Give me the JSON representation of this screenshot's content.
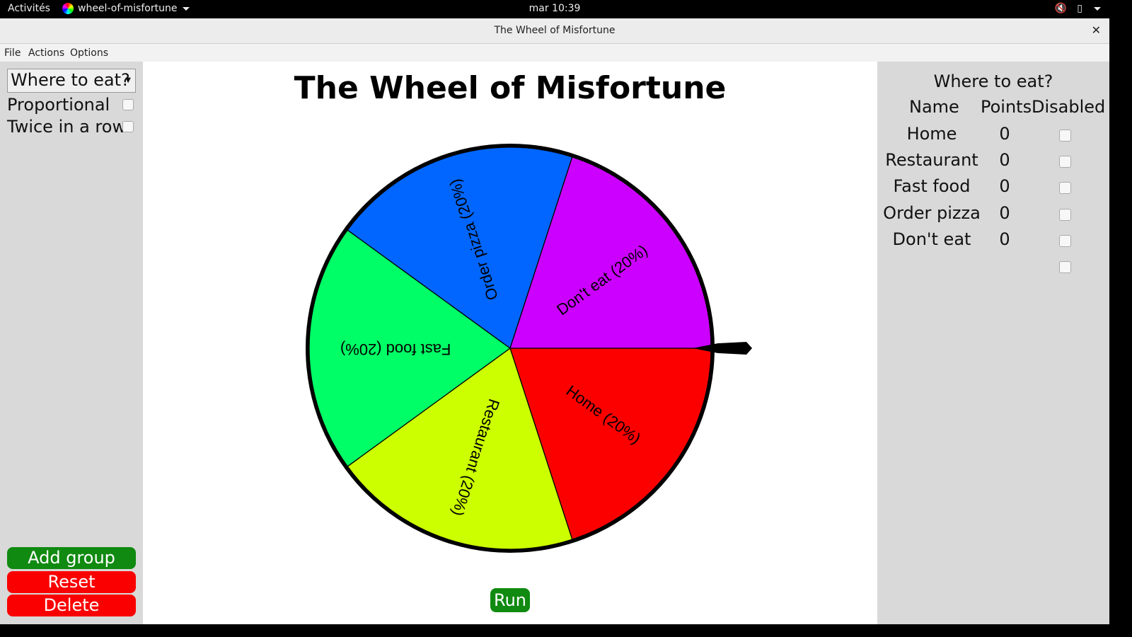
{
  "topbar": {
    "activities": "Activités",
    "app_name": "wheel-of-misfortune",
    "clock": "mar 10:39"
  },
  "window": {
    "title": "The Wheel of Misfortune"
  },
  "menu": {
    "file": "File",
    "actions": "Actions",
    "options": "Options"
  },
  "left": {
    "group_select": "Where to eat?",
    "proportional_label": "Proportional",
    "twice_label": "Twice in a row",
    "add_group": "Add group",
    "reset": "Reset",
    "delete": "Delete"
  },
  "main": {
    "heading": "The Wheel of Misfortune",
    "run": "Run"
  },
  "wheel": {
    "segments": [
      {
        "label": "Home (20%)",
        "color": "#fc0000",
        "fraction": 0.2
      },
      {
        "label": "Restaurant (20%)",
        "color": "#ccff00",
        "fraction": 0.2
      },
      {
        "label": "Fast food (20%)",
        "color": "#00ff66",
        "fraction": 0.2
      },
      {
        "label": "Order pizza (20%)",
        "color": "#0066ff",
        "fraction": 0.2
      },
      {
        "label": "Don't eat (20%)",
        "color": "#cc00ff",
        "fraction": 0.2
      }
    ]
  },
  "right": {
    "title": "Where to eat?",
    "headers": {
      "name": "Name",
      "points": "Points",
      "disabled": "Disabled"
    },
    "rows": [
      {
        "name": "Home",
        "points": "0"
      },
      {
        "name": "Restaurant",
        "points": "0"
      },
      {
        "name": "Fast food",
        "points": "0"
      },
      {
        "name": "Order pizza",
        "points": "0"
      },
      {
        "name": "Don't eat",
        "points": "0"
      },
      {
        "name": "",
        "points": ""
      }
    ]
  },
  "colors": {
    "green_button": "#108a10",
    "red_button": "#fa0000",
    "panel_bg": "#d9d9d9"
  }
}
